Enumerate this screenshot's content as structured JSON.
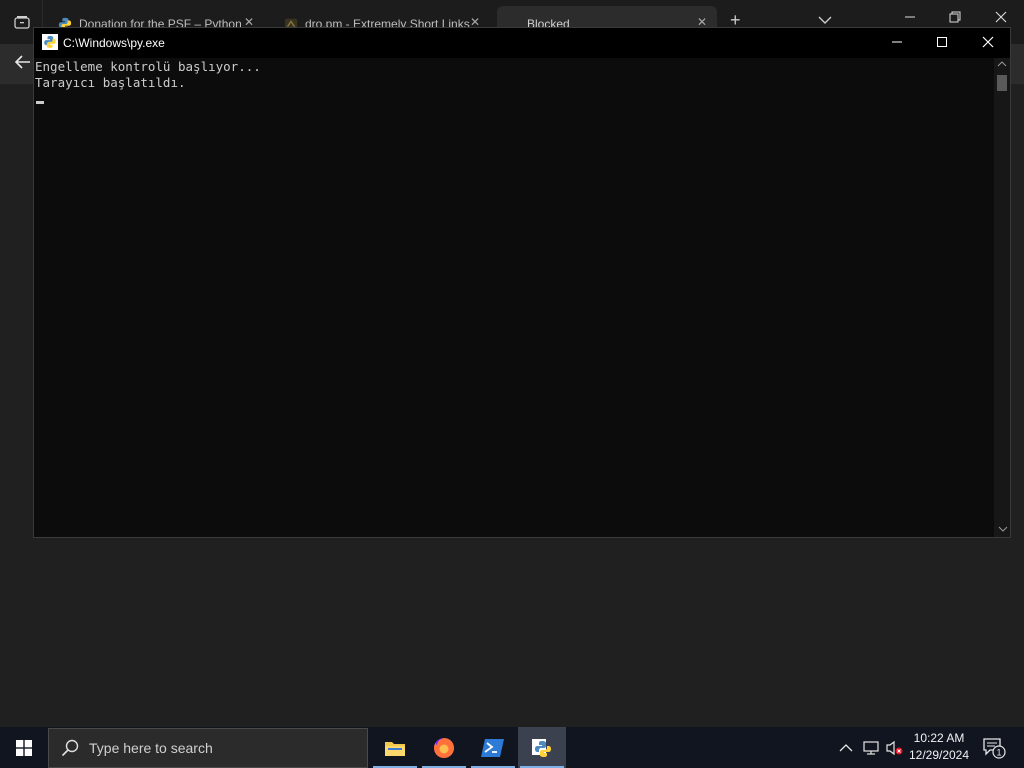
{
  "browser": {
    "tabs": [
      {
        "label": "Donation for the PSF – Python"
      },
      {
        "label": "dro.pm - Extremely Short Links"
      },
      {
        "label": "Blocked"
      }
    ],
    "new_tab_label": "+"
  },
  "console": {
    "title": "C:\\Windows\\py.exe",
    "lines": [
      "Engelleme kontrolü başlıyor...",
      "Tarayıcı başlatıldı."
    ]
  },
  "taskbar": {
    "search_placeholder": "Type here to search",
    "clock_time": "10:22 AM",
    "clock_date": "12/29/2024",
    "notification_count": "1"
  }
}
